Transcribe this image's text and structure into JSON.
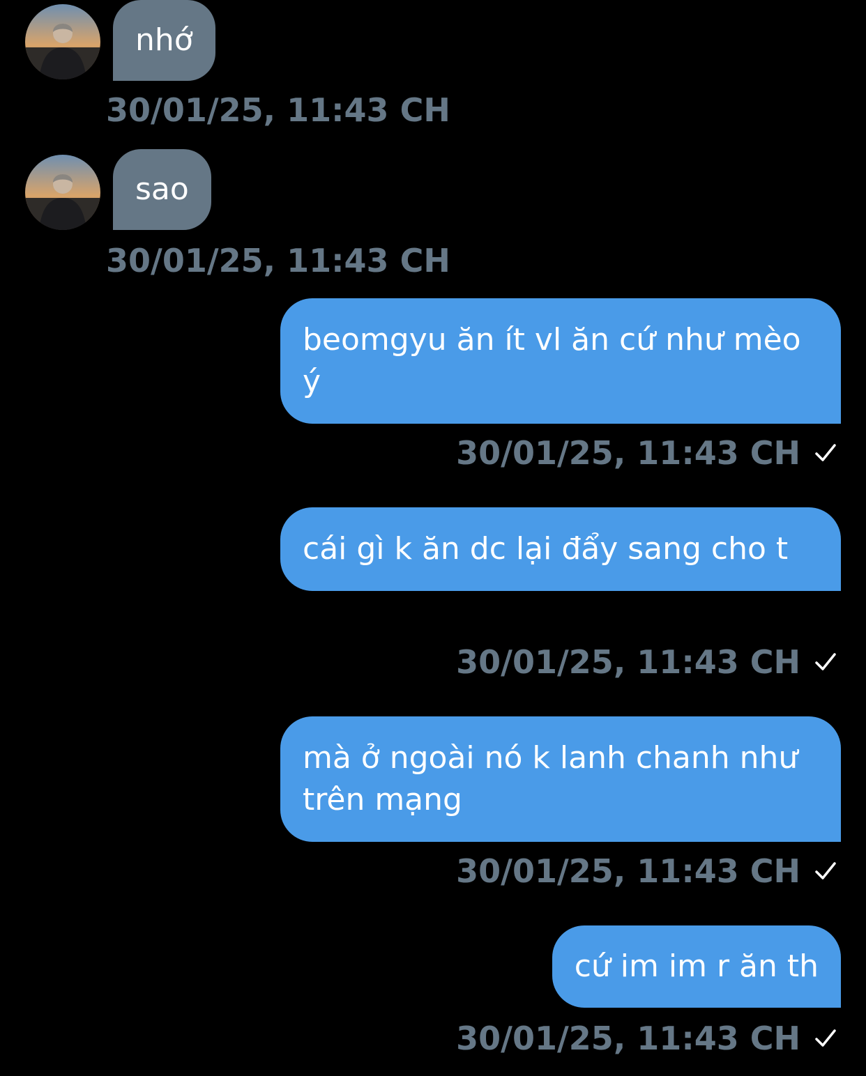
{
  "colors": {
    "background": "#000000",
    "incoming_bubble": "#657786",
    "outgoing_bubble": "#4a9be8",
    "timestamp": "#657786",
    "text": "#ffffff"
  },
  "incoming": [
    {
      "text": "nhớ",
      "time": "30/01/25, 11:43 CH",
      "avatar_icon": "user-avatar"
    },
    {
      "text": "sao",
      "time": "30/01/25, 11:43 CH",
      "avatar_icon": "user-avatar"
    }
  ],
  "outgoing": [
    {
      "text": "beomgyu ăn ít vl ăn cứ như mèo ý",
      "time": "30/01/25, 11:43 CH",
      "status_icon": "check-icon"
    },
    {
      "text": "cái gì k ăn dc lại đẩy sang cho t",
      "time": "30/01/25, 11:43 CH",
      "status_icon": "check-icon"
    },
    {
      "text": "mà ở ngoài nó k lanh chanh như trên mạng",
      "time": "30/01/25, 11:43 CH",
      "status_icon": "check-icon"
    },
    {
      "text": "cứ im im r ăn th",
      "time": "30/01/25, 11:43 CH",
      "status_icon": "check-icon"
    }
  ]
}
